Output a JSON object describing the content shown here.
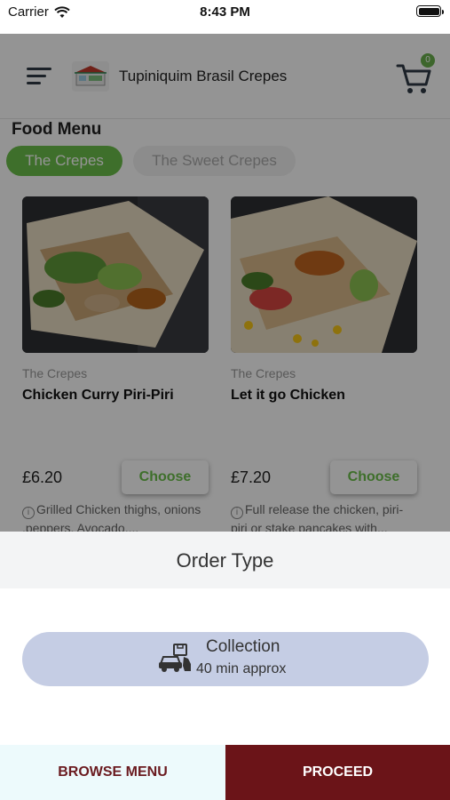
{
  "status_bar": {
    "carrier": "Carrier",
    "time": "8:43 PM"
  },
  "header": {
    "title": "Tupiniquim Brasil Crepes",
    "cart_count": "0"
  },
  "menu": {
    "section_title": "Food Menu",
    "tabs": [
      {
        "label": "The Crepes",
        "active": true
      },
      {
        "label": "The Sweet Crepes",
        "active": false
      }
    ],
    "items": [
      {
        "category": "The Crepes",
        "name": "Chicken Curry Piri-Piri",
        "price": "£6.20",
        "button_label": "Choose",
        "description": "Grilled Chicken thighs, onions ,peppers, Avocado,..."
      },
      {
        "category": "The Crepes",
        "name": "Let it go Chicken",
        "price": "£7.20",
        "button_label": "Choose",
        "description": "Full release the chicken, piri-piri or stake pancakes with..."
      }
    ]
  },
  "order_sheet": {
    "title": "Order Type",
    "option_label": "Collection",
    "option_time": "40 min approx"
  },
  "bottom_bar": {
    "browse_label": "BROWSE MENU",
    "proceed_label": "PROCEED"
  },
  "colors": {
    "accent_green": "#6cc04a",
    "proceed_bg": "#6b1418",
    "collection_bg": "#c5cde4"
  }
}
